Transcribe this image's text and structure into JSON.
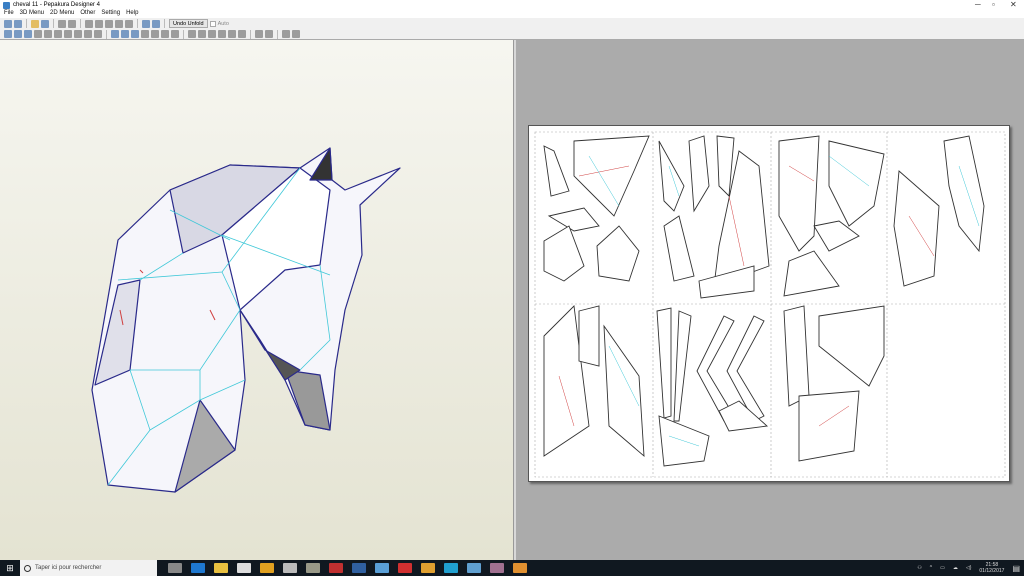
{
  "window": {
    "title": "cheval 11 - Pepakura Designer 4",
    "minimize": "─",
    "maximize": "▫",
    "close": "✕"
  },
  "menu": [
    "File",
    "3D Menu",
    "2D Menu",
    "Other",
    "Setting",
    "Help"
  ],
  "toolbar": {
    "undo_unfold": "Undo Unfold",
    "auto": "Auto"
  },
  "taskbar": {
    "search_placeholder": "Taper ici pour rechercher",
    "time": "21:58",
    "date": "01/12/2017",
    "apps": [
      "task-view",
      "edge",
      "file-explorer",
      "mail",
      "store",
      "app-printer",
      "app-display",
      "app-red",
      "app-blue",
      "steam",
      "app-red2",
      "chrome",
      "app-cyan",
      "pepakura",
      "app-film",
      "app-orange"
    ],
    "app_colors": [
      "#888",
      "#1e78d0",
      "#e8c040",
      "#ddd",
      "#e0a020",
      "#bbb",
      "#998",
      "#c03030",
      "#3060a0",
      "#5aa0d8",
      "#d03030",
      "#e0a030",
      "#20a0d0",
      "#60a0d0",
      "#a07090",
      "#e09030"
    ]
  },
  "colors": {
    "edge_blue": "#2a2a8a",
    "fold_cyan": "#40c8d8",
    "fold_red": "#d04040"
  }
}
